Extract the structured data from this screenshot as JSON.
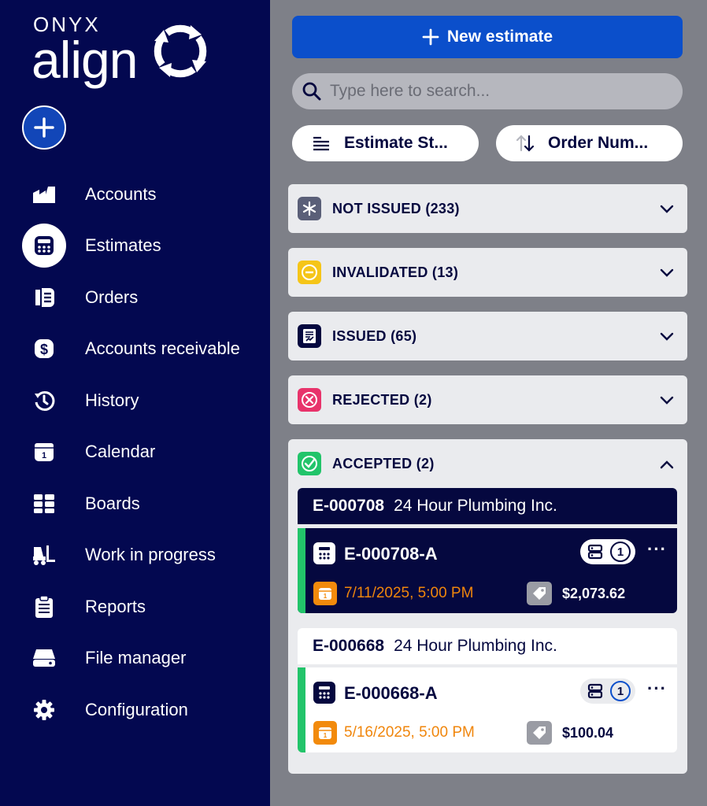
{
  "brand": {
    "top": "ONYX",
    "main": "align"
  },
  "sidebar": {
    "items": [
      {
        "label": "Accounts",
        "icon": "factory-icon",
        "active": false
      },
      {
        "label": "Estimates",
        "icon": "calculator-icon",
        "active": true
      },
      {
        "label": "Orders",
        "icon": "orders-icon",
        "active": false
      },
      {
        "label": "Accounts receivable",
        "icon": "dollar-icon",
        "active": false
      },
      {
        "label": "History",
        "icon": "history-icon",
        "active": false
      },
      {
        "label": "Calendar",
        "icon": "calendar-icon",
        "active": false
      },
      {
        "label": "Boards",
        "icon": "boards-icon",
        "active": false
      },
      {
        "label": "Work in progress",
        "icon": "forklift-icon",
        "active": false
      },
      {
        "label": "Reports",
        "icon": "clipboard-icon",
        "active": false
      },
      {
        "label": "File manager",
        "icon": "drive-icon",
        "active": false
      },
      {
        "label": "Configuration",
        "icon": "gear-icon",
        "active": false
      }
    ]
  },
  "toolbar": {
    "new_label": "New estimate",
    "search_placeholder": "Type here to search...",
    "filter_label": "Estimate St...",
    "sort_label": "Order Num..."
  },
  "groups": [
    {
      "label": "NOT ISSUED (233)",
      "color": "#5a5f78"
    },
    {
      "label": "INVALIDATED (13)",
      "color": "#f5c518"
    },
    {
      "label": "ISSUED (65)",
      "color": "#05083f"
    },
    {
      "label": "REJECTED (2)",
      "color": "#e8336b"
    },
    {
      "label": "ACCEPTED (2)",
      "color": "#22c46a"
    }
  ],
  "estimates": [
    {
      "number": "E-000708",
      "company": "24 Hour Plumbing Inc.",
      "version": "E-000708-A",
      "count": "1",
      "date": "7/11/2025, 5:00 PM",
      "price": "$2,073.62",
      "selected": true
    },
    {
      "number": "E-000668",
      "company": "24 Hour Plumbing Inc.",
      "version": "E-000668-A",
      "count": "1",
      "date": "5/16/2025, 5:00 PM",
      "price": "$100.04",
      "selected": false
    }
  ],
  "colors": {
    "sidebar": "#030850",
    "accent": "#0b4fcb",
    "success": "#22c46a",
    "date": "#f0860c"
  }
}
